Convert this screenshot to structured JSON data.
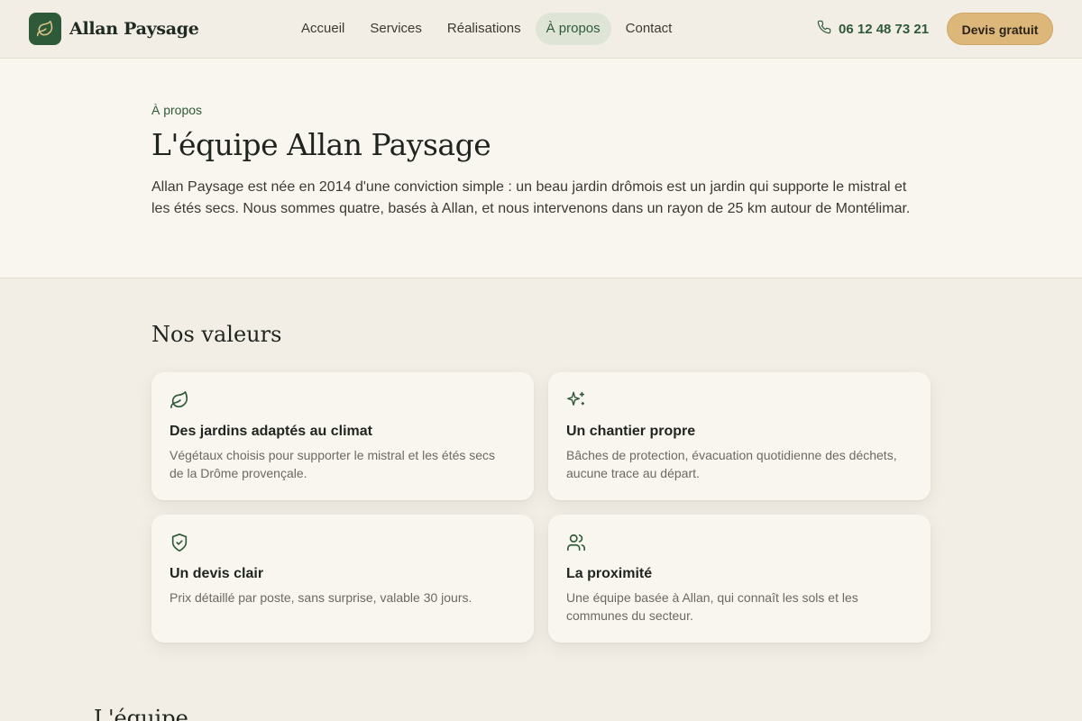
{
  "header": {
    "logo_text": "Allan Paysage",
    "logo_icon": "leaf-icon",
    "nav": [
      {
        "label": "Accueil"
      },
      {
        "label": "Services"
      },
      {
        "label": "Réalisations"
      },
      {
        "label": "À propos",
        "active": true
      },
      {
        "label": "Contact"
      }
    ],
    "phone": "06 12 48 73 21",
    "cta_label": "Devis gratuit"
  },
  "hero": {
    "eyebrow": "À propos",
    "title": "L'équipe Allan Paysage",
    "text": "Allan Paysage est née en 2014 d'une conviction simple : un beau jardin drômois est un jardin qui supporte le mistral et les étés secs. Nous sommes quatre, basés à Allan, et nous intervenons dans un rayon de 25 km autour de Montélimar."
  },
  "values": {
    "title": "Nos valeurs",
    "cards": [
      {
        "icon": "leaf-icon",
        "title": "Des jardins adaptés au climat",
        "text": "Végétaux choisis pour supporter le mistral et les étés secs de la Drôme provençale."
      },
      {
        "icon": "sparkles-icon",
        "title": "Un chantier propre",
        "text": "Bâches de protection, évacuation quotidienne des déchets, aucune trace au départ."
      },
      {
        "icon": "shield-check-icon",
        "title": "Un devis clair",
        "text": "Prix détaillé par poste, sans surprise, valable 30 jours."
      },
      {
        "icon": "users-icon",
        "title": "La proximité",
        "text": "Une équipe basée à Allan, qui connaît les sols et les communes du secteur."
      }
    ]
  },
  "team": {
    "title": "L'équipe"
  },
  "colors": {
    "brand_green": "#2f5a3a",
    "cta": "#ddb67a",
    "background": "#f2eee6",
    "card": "#f9f6ef"
  }
}
